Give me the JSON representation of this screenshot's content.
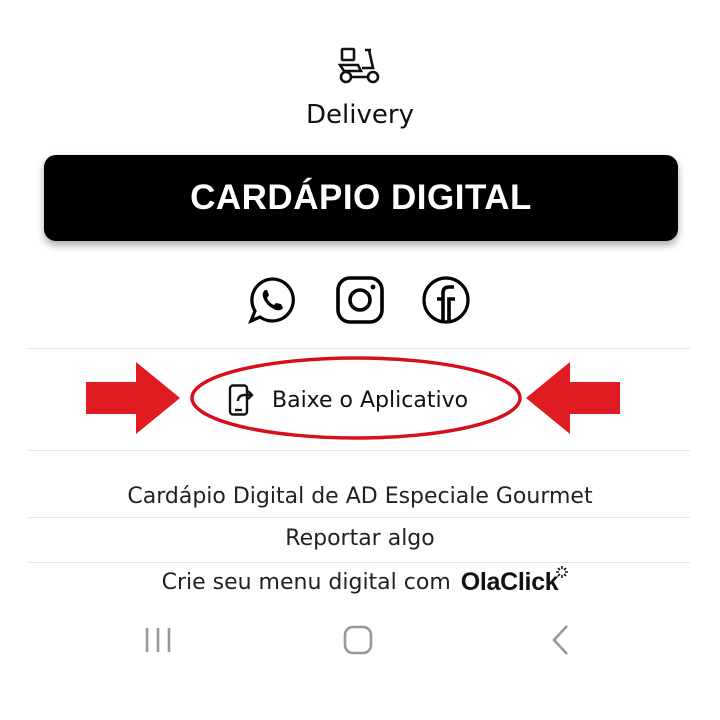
{
  "delivery": {
    "icon": "scooter-delivery-icon",
    "label": "Delivery"
  },
  "menu_button": {
    "label": "CARDÁPIO DIGITAL",
    "color": "#000000"
  },
  "social": [
    {
      "name": "WhatsApp",
      "icon": "whatsapp-icon"
    },
    {
      "name": "Instagram",
      "icon": "instagram-icon"
    },
    {
      "name": "Facebook",
      "icon": "facebook-icon"
    }
  ],
  "app_download": {
    "label": "Baixe o Aplicativo",
    "icon": "phone-share-icon",
    "highlight_color": "#e11b22"
  },
  "footer": {
    "title": "Cardápio Digital de AD Especiale Gourmet",
    "report_label": "Reportar algo",
    "create_text": "Crie seu menu digital com",
    "brand": "OlaClick"
  },
  "nav": {
    "recent": "recent-apps-icon",
    "home": "home-icon",
    "back": "back-icon"
  }
}
